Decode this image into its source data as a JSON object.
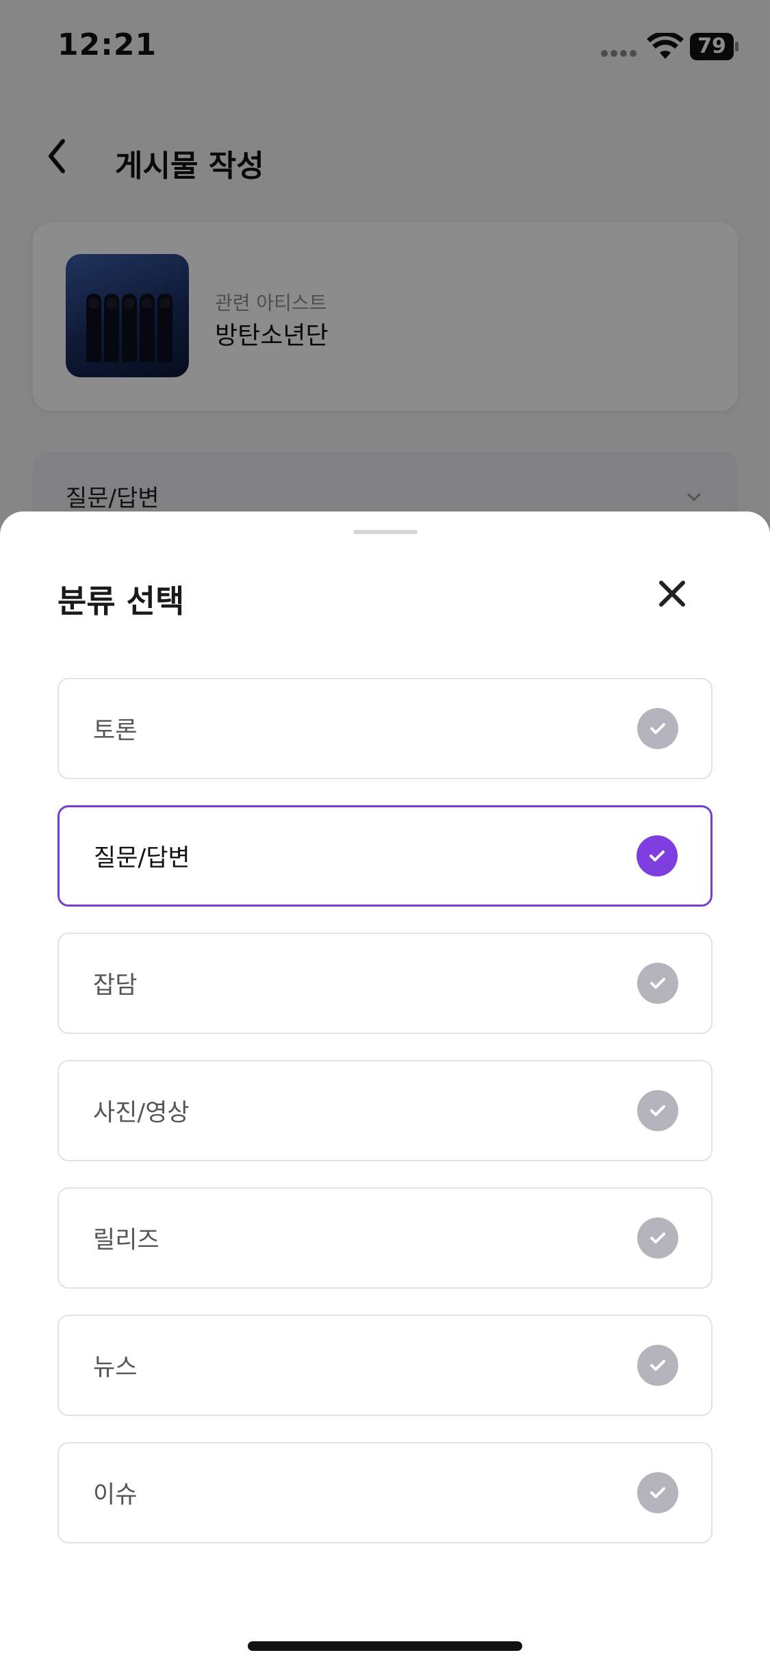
{
  "status_bar": {
    "time": "12:21",
    "battery": "79"
  },
  "nav": {
    "title": "게시물 작성"
  },
  "artist_card": {
    "label": "관련 아티스트",
    "name": "방탄소년단"
  },
  "category_field": {
    "value": "질문/답변"
  },
  "sheet": {
    "title": "분류 선택",
    "options": [
      {
        "label": "토론",
        "selected": false
      },
      {
        "label": "질문/답변",
        "selected": true
      },
      {
        "label": "잡담",
        "selected": false
      },
      {
        "label": "사진/영상",
        "selected": false
      },
      {
        "label": "릴리즈",
        "selected": false
      },
      {
        "label": "뉴스",
        "selected": false
      },
      {
        "label": "이슈",
        "selected": false
      }
    ]
  },
  "colors": {
    "accent": "#7f3fe0",
    "accent_border": "#7a3bd0",
    "unselected_check": "#b4b4bc"
  },
  "icons": {
    "close": "close-icon",
    "check": "check-icon",
    "back": "chevron-left-icon",
    "dropdown": "chevron-down-icon"
  }
}
